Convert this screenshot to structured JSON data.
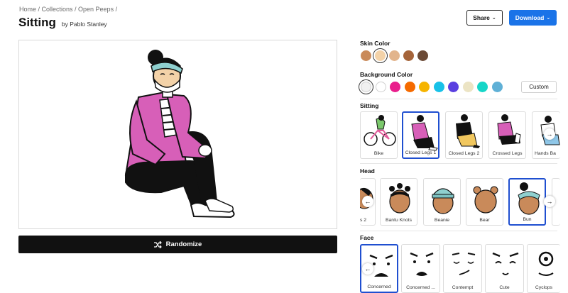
{
  "breadcrumb": "Home / Collections / Open Peeps /",
  "title": "Sitting",
  "author": "by Pablo Stanley",
  "share_label": "Share",
  "download_label": "Download",
  "randomize_label": "Randomize",
  "skin": {
    "label": "Skin Color",
    "colors": [
      "#c98a5a",
      "#f3d2a8",
      "#e2b48c",
      "#a5643a",
      "#6b4a36"
    ],
    "selected_index": 1
  },
  "background": {
    "label": "Background Color",
    "colors": [
      "#f0f0f0",
      "#ffffff",
      "#e91e8c",
      "#f56a00",
      "#f6b400",
      "#17c1e8",
      "#5a3fe0",
      "#ece4c4",
      "#16d6c8",
      "#5fb0d6"
    ],
    "selected_index": 0,
    "custom_label": "Custom"
  },
  "sitting": {
    "label": "Sitting",
    "items": [
      "Bike",
      "Closed Legs 1",
      "Closed Legs 2",
      "Crossed Legs",
      "Hands Ba"
    ],
    "selected_index": 1
  },
  "head": {
    "label": "Head",
    "items": [
      "s 2",
      "Bantu Knots",
      "Beanie",
      "Bear",
      "Bun",
      ""
    ],
    "selected_index": 4
  },
  "face": {
    "label": "Face",
    "items": [
      "Concerned",
      "Concerned ...",
      "Contempt",
      "Cute",
      "Cyclops"
    ],
    "selected_index": 0
  },
  "colors": {
    "accent": "#1a73e8",
    "selected_border": "#1f4fd0",
    "shirt": "#d75fb8",
    "pants": "#111111",
    "bandana": "#8fd0cf"
  }
}
